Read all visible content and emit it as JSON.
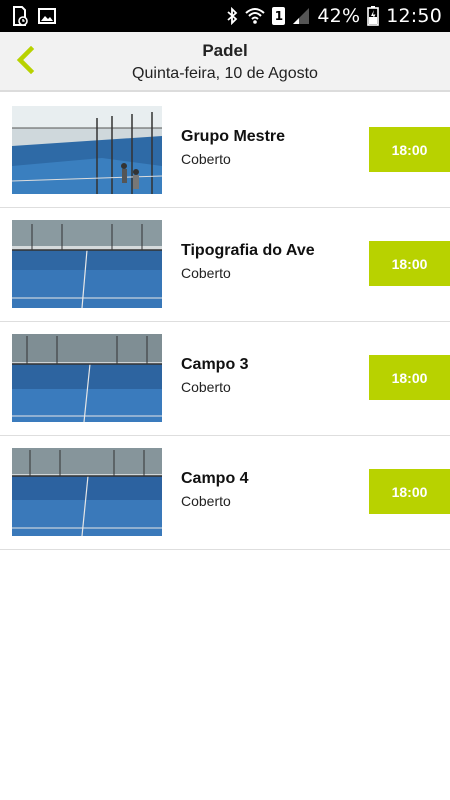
{
  "status_bar": {
    "battery_percent": "42%",
    "time": "12:50",
    "sim_badge": "1",
    "icons": [
      "sd-card-icon",
      "image-icon",
      "bluetooth-icon",
      "wifi-icon",
      "sim-icon",
      "signal-icon",
      "battery-icon"
    ]
  },
  "header": {
    "title": "Padel",
    "subtitle": "Quinta-feira, 10 de Agosto",
    "back_icon": "chevron-left-icon",
    "accent_color": "#b8d200"
  },
  "courts": [
    {
      "name": "Grupo Mestre",
      "type": "Coberto",
      "time": "18:00"
    },
    {
      "name": "Tipografia do Ave",
      "type": "Coberto",
      "time": "18:00"
    },
    {
      "name": "Campo 3",
      "type": "Coberto",
      "time": "18:00"
    },
    {
      "name": "Campo 4",
      "type": "Coberto",
      "time": "18:00"
    }
  ]
}
